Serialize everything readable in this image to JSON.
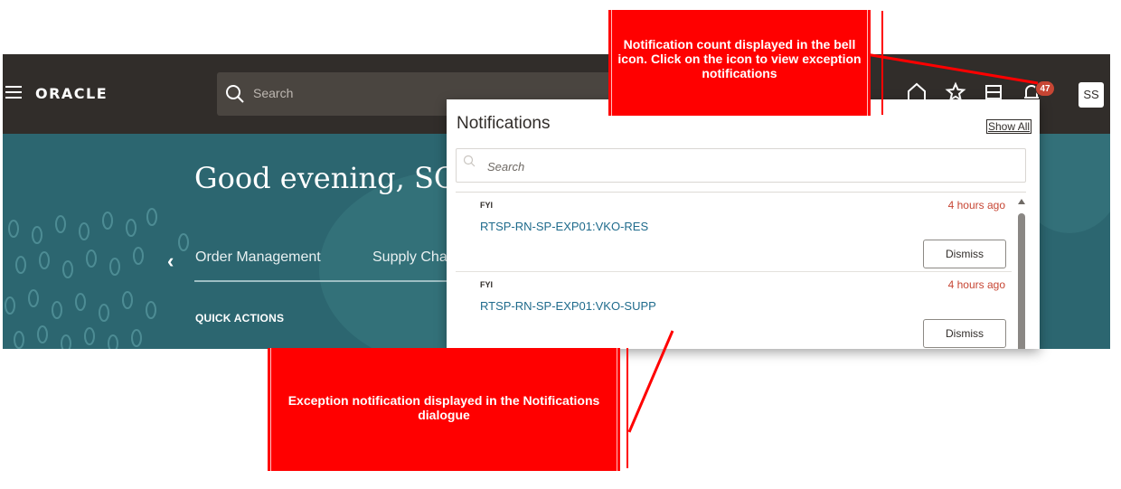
{
  "header": {
    "menu_icon": "hamburger-menu-icon",
    "logo_text": "ORACLE",
    "search_placeholder": "Search",
    "icons": [
      "home-icon",
      "star-icon",
      "bookmark-icon",
      "bell-icon"
    ],
    "notification_count": "47",
    "user_initials": "SS"
  },
  "hero": {
    "greeting": "Good evening, SC",
    "tabs": [
      "Order Management",
      "Supply Cha"
    ],
    "quick_actions_label": "QUICK ACTIONS",
    "background_color": "#2c6670"
  },
  "notifications": {
    "title": "Notifications",
    "show_all": "Show All",
    "search_placeholder": "Search",
    "items": [
      {
        "type": "FYI",
        "time": "4 hours ago",
        "link_text": "RTSP-RN-SP-EXP01:VKO-RES",
        "action": "Dismiss"
      },
      {
        "type": "FYI",
        "time": "4 hours ago",
        "link_text": "RTSP-RN-SP-EXP01:VKO-SUPP",
        "action": "Dismiss"
      }
    ]
  },
  "annotations": {
    "top": "Notification count displayed in the bell icon. Click on the icon to view exception notifications",
    "bottom": "Exception notification displayed in the Notifications dialogue",
    "color": "#ff0000"
  }
}
